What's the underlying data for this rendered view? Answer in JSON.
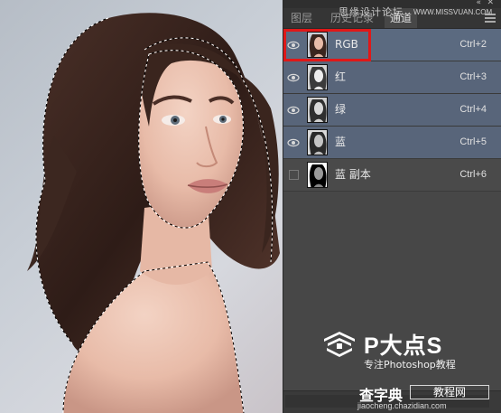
{
  "watermark": {
    "text": "思缘设计论坛",
    "url": "WWW.MISSVUAN.COM"
  },
  "panel": {
    "tabs": [
      {
        "label": "图层"
      },
      {
        "label": "历史记录"
      },
      {
        "label": "通道"
      }
    ],
    "channels": [
      {
        "label": "RGB",
        "shortcut": "Ctrl+2",
        "visible": true
      },
      {
        "label": "红",
        "shortcut": "Ctrl+3",
        "visible": true
      },
      {
        "label": "绿",
        "shortcut": "Ctrl+4",
        "visible": true
      },
      {
        "label": "蓝",
        "shortcut": "Ctrl+5",
        "visible": true
      },
      {
        "label": "蓝 副本",
        "shortcut": "Ctrl+6",
        "visible": false
      }
    ],
    "highlight_color": "#e01818",
    "selected_color": "#58657a"
  },
  "brand": {
    "title": "P大点S",
    "subtitle": "专注Photoshop教程"
  },
  "site": {
    "name": "查字典",
    "box_text": "教程网",
    "url": "jiaocheng.chazidian.com"
  },
  "icons": {
    "eye": "eye-icon",
    "collapse": "double-chevron-icon",
    "close": "close-icon",
    "menu": "panel-menu-icon",
    "logo": "brand-logo-icon"
  }
}
